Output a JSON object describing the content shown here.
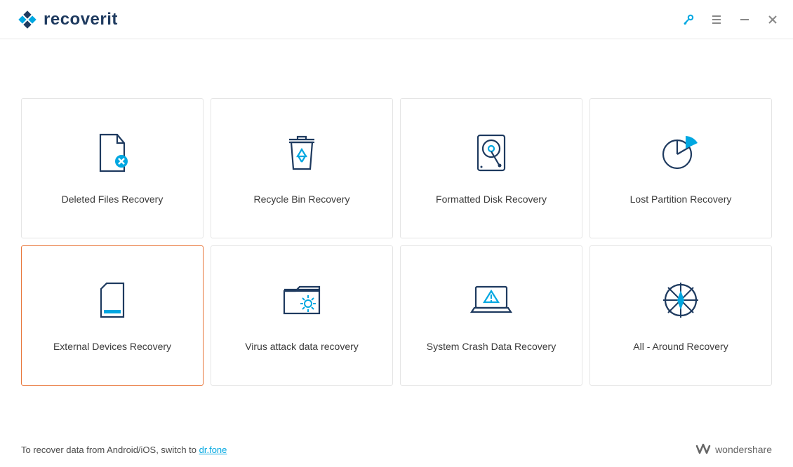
{
  "brand": "recoverit",
  "cards": [
    {
      "label": "Deleted Files Recovery",
      "selected": false
    },
    {
      "label": "Recycle Bin Recovery",
      "selected": false
    },
    {
      "label": "Formatted Disk Recovery",
      "selected": false
    },
    {
      "label": "Lost Partition Recovery",
      "selected": false
    },
    {
      "label": "External Devices Recovery",
      "selected": true
    },
    {
      "label": "Virus attack data recovery",
      "selected": false
    },
    {
      "label": "System Crash Data Recovery",
      "selected": false
    },
    {
      "label": "All - Around Recovery",
      "selected": false
    }
  ],
  "footer": {
    "prefix": "To recover data from Android/iOS, switch to",
    "link": " dr.fone",
    "company": "wondershare"
  },
  "colors": {
    "accent": "#00a7e1",
    "navy": "#1e3a5f",
    "selected_border": "#e8763a"
  }
}
